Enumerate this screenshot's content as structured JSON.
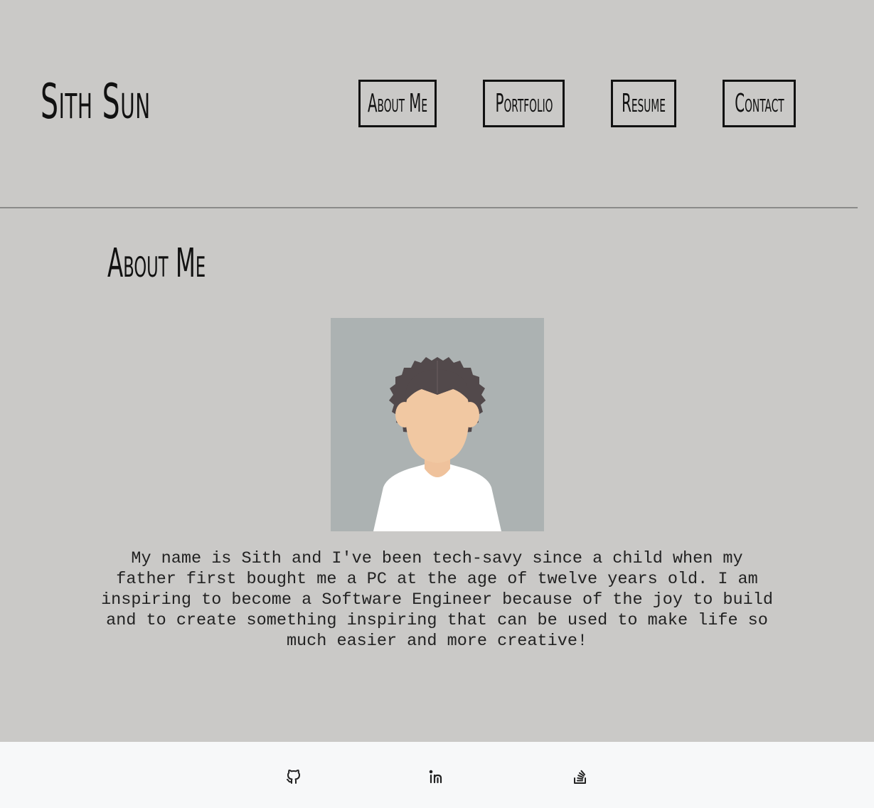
{
  "header": {
    "site_title": "Sith Sun",
    "nav": [
      {
        "label": "About Me"
      },
      {
        "label": "Portfolio"
      },
      {
        "label": "Resume"
      },
      {
        "label": "Contact"
      }
    ]
  },
  "main": {
    "section_title": "About Me",
    "avatar": {
      "icon": "avatar-illustration",
      "background_color": "#acb2b2",
      "hair_color": "#52494b",
      "skin_color": "#f1c8a2",
      "shirt_color": "#ffffff"
    },
    "bio": "My name is Sith and I've been tech-savy since a child when my father first bought me a PC at the age of twelve years old. I am inspiring to become a Software Engineer because of the joy to build and to create something inspiring that can be used to make life so much easier and more creative!"
  },
  "footer": {
    "links": [
      {
        "icon": "github-icon"
      },
      {
        "icon": "linkedin-icon"
      },
      {
        "icon": "stackoverflow-icon"
      }
    ]
  },
  "colors": {
    "page_background": "#cac9c7",
    "footer_background": "#f7f8f9",
    "text": "#111111",
    "divider": "#8a8a89"
  }
}
